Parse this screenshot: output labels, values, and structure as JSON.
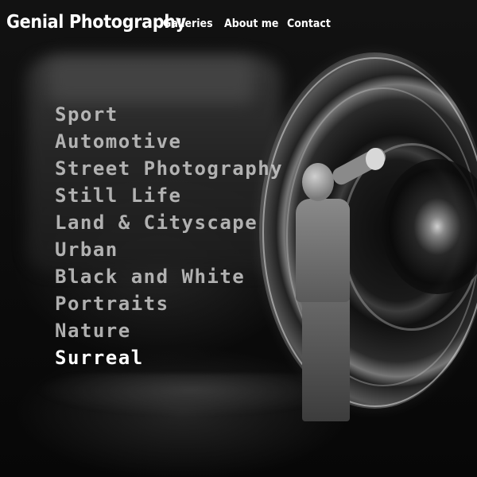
{
  "header": {
    "brand": "Genial Photography",
    "nav": [
      {
        "label": "Galleries"
      },
      {
        "label": "About me"
      },
      {
        "label": "Contact"
      }
    ]
  },
  "galleries": {
    "items": [
      {
        "label": "Sport"
      },
      {
        "label": "Automotive"
      },
      {
        "label": "Street Photography"
      },
      {
        "label": "Still Life"
      },
      {
        "label": "Land & Cityscape"
      },
      {
        "label": "Urban"
      },
      {
        "label": "Black and White"
      },
      {
        "label": "Portraits"
      },
      {
        "label": "Nature"
      },
      {
        "label": "Surreal"
      }
    ],
    "active_label": "Surreal"
  },
  "colors": {
    "background": "#0a0a0a",
    "text": "#ffffff",
    "inactive_link": "#d2d2d2"
  }
}
